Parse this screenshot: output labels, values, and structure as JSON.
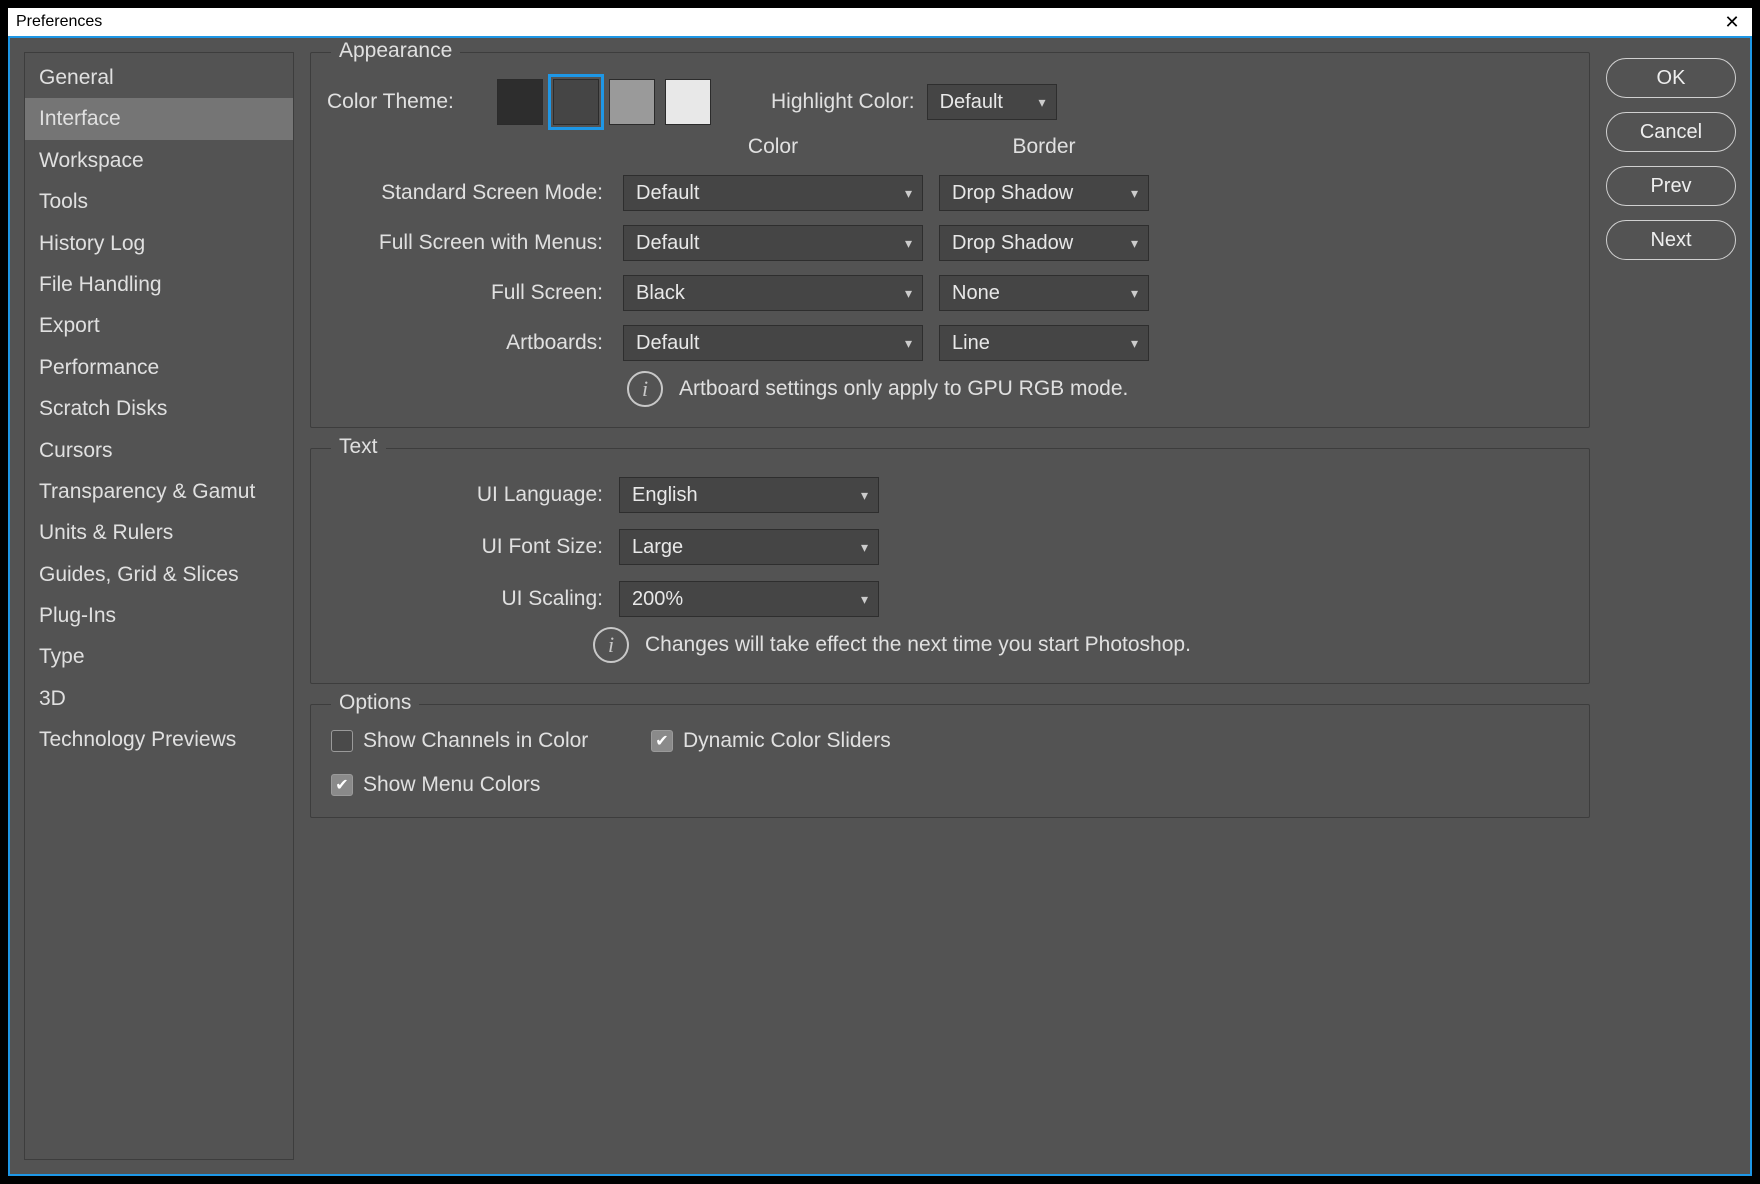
{
  "window": {
    "title": "Preferences"
  },
  "sidebar": {
    "items": [
      "General",
      "Interface",
      "Workspace",
      "Tools",
      "History Log",
      "File Handling",
      "Export",
      "Performance",
      "Scratch Disks",
      "Cursors",
      "Transparency & Gamut",
      "Units & Rulers",
      "Guides, Grid & Slices",
      "Plug-Ins",
      "Type",
      "3D",
      "Technology Previews"
    ],
    "selectedIndex": 1
  },
  "buttons": {
    "ok": "OK",
    "cancel": "Cancel",
    "prev": "Prev",
    "next": "Next"
  },
  "appearance": {
    "legend": "Appearance",
    "colorThemeLabel": "Color Theme:",
    "swatchColors": [
      "#2d2d2d",
      "#454545",
      "#9a9a9a",
      "#e8e8e8"
    ],
    "swatchSelectedIndex": 1,
    "highlightLabel": "Highlight Color:",
    "highlightValue": "Default",
    "headers": {
      "color": "Color",
      "border": "Border"
    },
    "rows": [
      {
        "label": "Standard Screen Mode:",
        "color": "Default",
        "border": "Drop Shadow"
      },
      {
        "label": "Full Screen with Menus:",
        "color": "Default",
        "border": "Drop Shadow"
      },
      {
        "label": "Full Screen:",
        "color": "Black",
        "border": "None"
      },
      {
        "label": "Artboards:",
        "color": "Default",
        "border": "Line"
      }
    ],
    "infoText": "Artboard settings only apply to GPU RGB mode."
  },
  "text": {
    "legend": "Text",
    "rows": [
      {
        "label": "UI Language:",
        "value": "English"
      },
      {
        "label": "UI Font Size:",
        "value": "Large"
      },
      {
        "label": "UI Scaling:",
        "value": "200%"
      }
    ],
    "infoText": "Changes will take effect the next time you start Photoshop."
  },
  "options": {
    "legend": "Options",
    "items": [
      {
        "label": "Show Channels in Color",
        "checked": false
      },
      {
        "label": "Dynamic Color Sliders",
        "checked": true
      },
      {
        "label": "Show Menu Colors",
        "checked": true
      }
    ]
  }
}
